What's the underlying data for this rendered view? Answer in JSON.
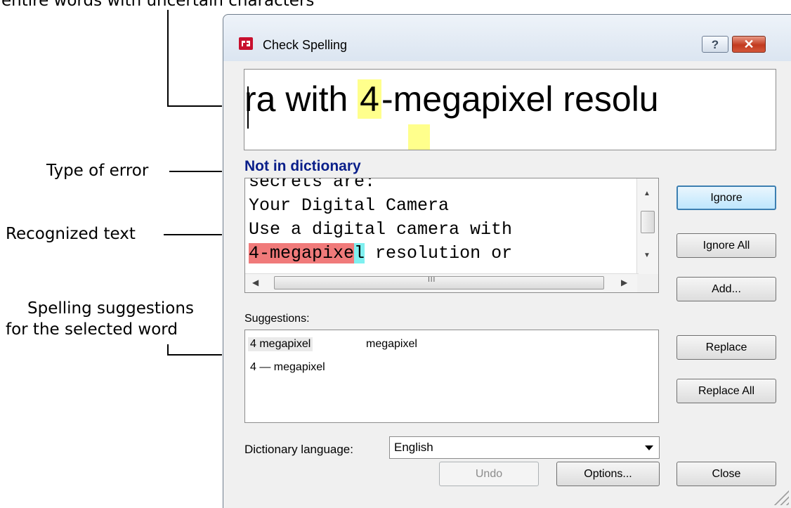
{
  "annotations": {
    "top_partial": "entire words with uncertain characters",
    "type_of_error": "Type of error",
    "recognized_text": "Recognized text",
    "suggestions_line1": "Spelling suggestions",
    "suggestions_line2": "for the selected word"
  },
  "dialog": {
    "title": "Check Spelling",
    "help_label": "?",
    "close_label": "✕",
    "preview": {
      "before": "ra with ",
      "highlight": "4",
      "after": "-megapixel resolu"
    },
    "error_type": "Not in dictionary",
    "recognized": {
      "line1": "secrets are:",
      "line2": "Your Digital Camera",
      "line3": "Use a digital camera with",
      "line4_red": "4-megapixe",
      "line4_cyan": "l",
      "line4_rest": " resolution or"
    },
    "suggestions_label": "Suggestions:",
    "suggestions": [
      "4 megapixel",
      "megapixel",
      "4 — megapixel"
    ],
    "dictionary_label": "Dictionary language:",
    "dictionary_value": "English",
    "buttons": {
      "ignore": "Ignore",
      "ignore_all": "Ignore All",
      "add": "Add...",
      "replace": "Replace",
      "replace_all": "Replace All",
      "undo": "Undo",
      "options": "Options...",
      "close": "Close"
    }
  },
  "colors": {
    "error_type": "#0a1f8a",
    "highlight_yellow": "#ffff8c",
    "highlight_red": "#f07a7a",
    "highlight_cyan": "#7ff0f0",
    "default_button_border": "#3c7fb1"
  }
}
